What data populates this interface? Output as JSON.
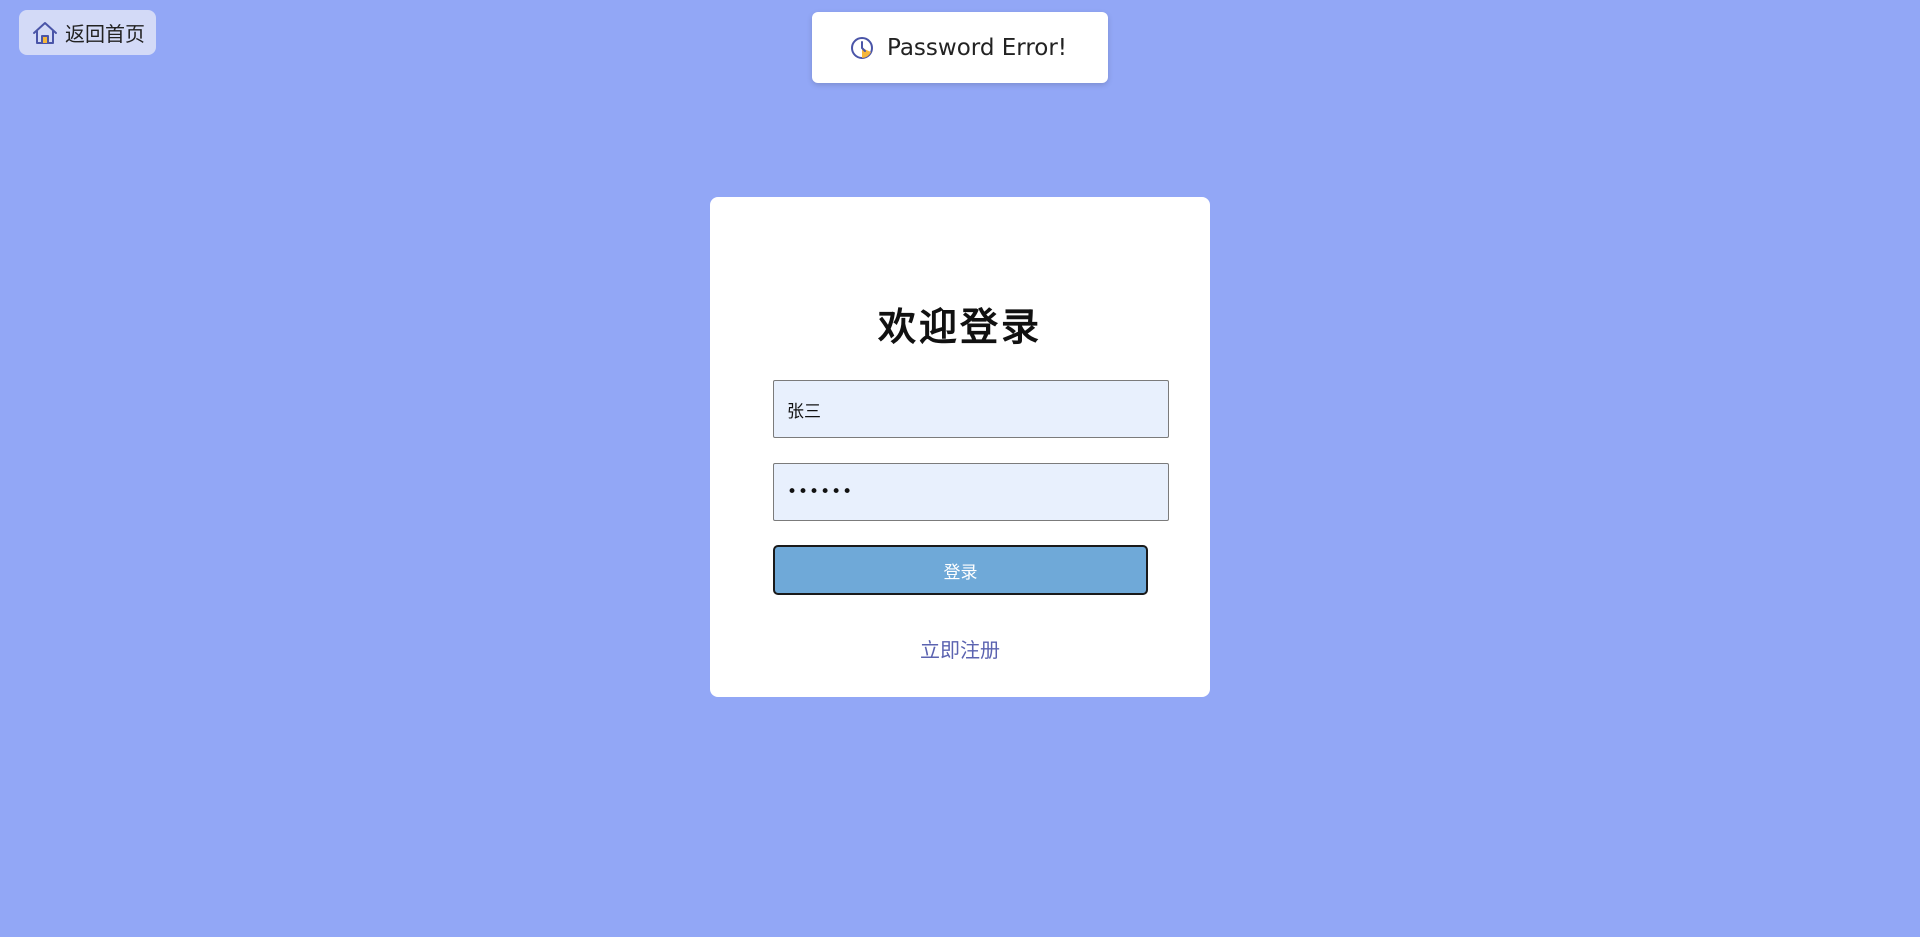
{
  "home_button": {
    "label": "返回首页",
    "icon": "home-icon"
  },
  "toast": {
    "icon": "clock-icon",
    "message": "Password Error!"
  },
  "login_card": {
    "title": "欢迎登录",
    "username_value": "张三",
    "password_value": "••••••",
    "login_button_label": "登录",
    "register_link_label": "立即注册"
  },
  "colors": {
    "background": "#92a7f6",
    "card": "#ffffff",
    "input_bg": "#e8f0fd",
    "button": "#6fa9d8",
    "link": "#5b63b0"
  }
}
